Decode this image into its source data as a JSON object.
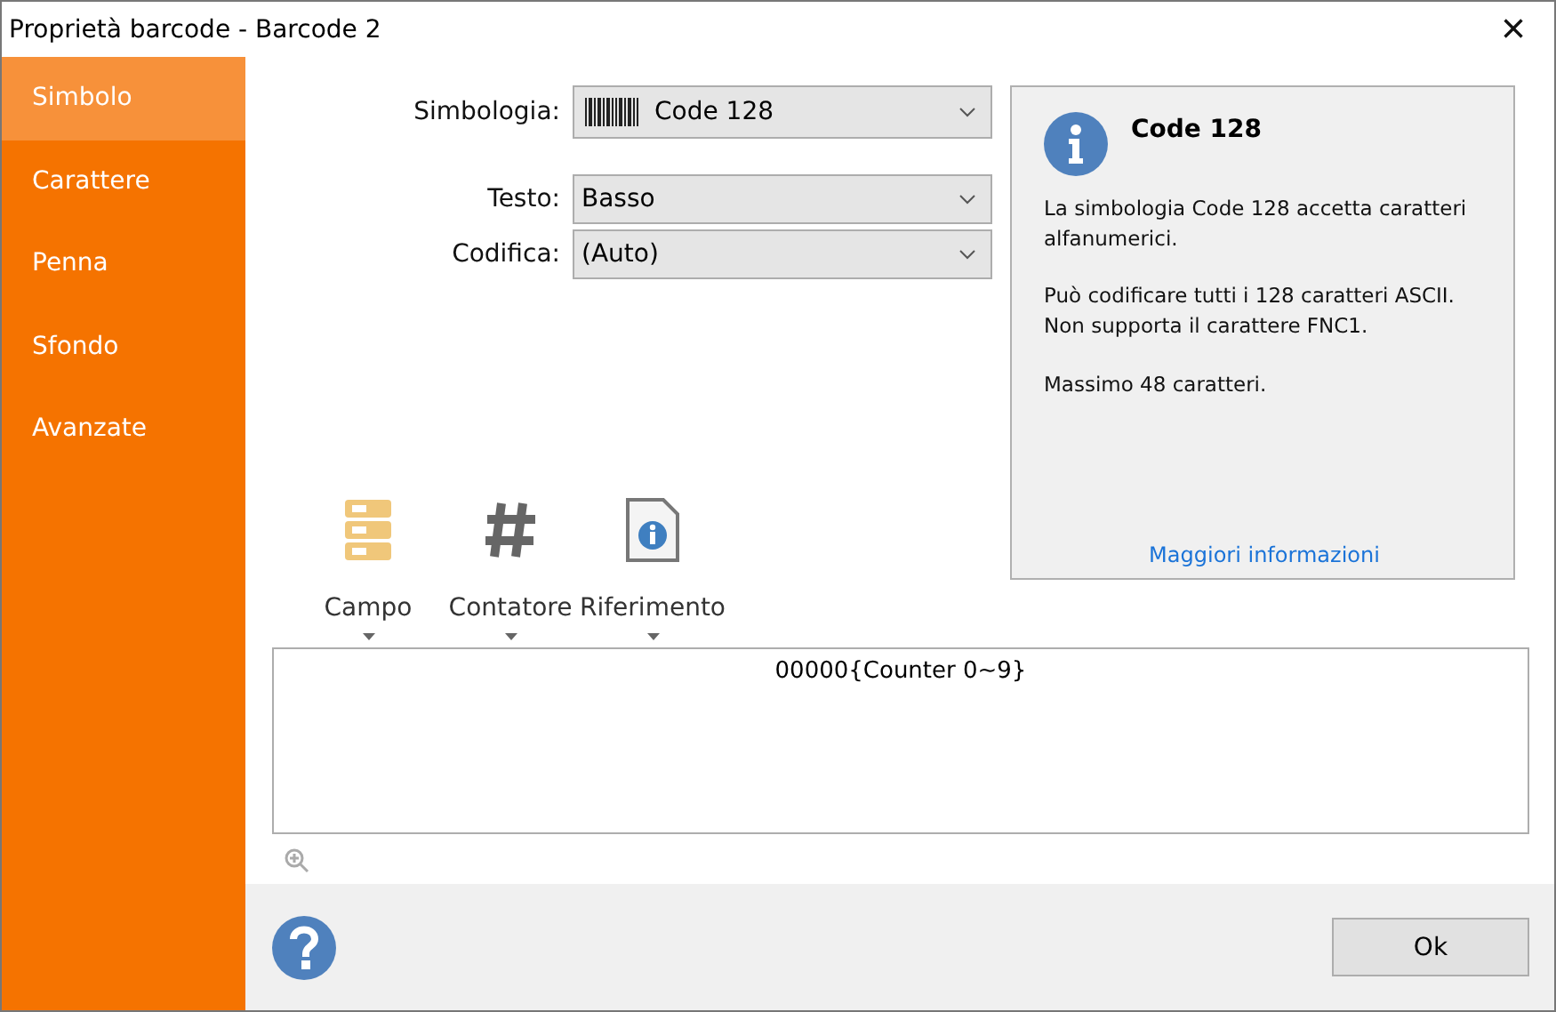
{
  "window": {
    "title": "Proprietà barcode - Barcode 2",
    "close": "×"
  },
  "sidebar": {
    "items": [
      {
        "label": "Simbolo",
        "selected": true
      },
      {
        "label": "Carattere",
        "selected": false
      },
      {
        "label": "Penna",
        "selected": false
      },
      {
        "label": "Sfondo",
        "selected": false
      },
      {
        "label": "Avanzate",
        "selected": false
      }
    ]
  },
  "form": {
    "fields": [
      {
        "label": "Simbologia:",
        "value": "Code 128",
        "kind": "barcode"
      },
      {
        "label": "Testo:",
        "value": "Basso",
        "kind": "plain"
      },
      {
        "label": "Codifica:",
        "value": "(Auto)",
        "kind": "plain"
      }
    ]
  },
  "info": {
    "title": "Code 128",
    "paragraphs": [
      "La simbologia Code 128 accetta caratteri\nalfanumerici.",
      "Può codificare tutti i 128 caratteri ASCII.\nNon supporta il carattere FNC1.",
      "Massimo 48 caratteri."
    ],
    "link": "Maggiori informazioni"
  },
  "toolbar": [
    {
      "label": "Campo",
      "kind": "field"
    },
    {
      "label": "Contatore",
      "kind": "counter"
    },
    {
      "label": "Riferimento",
      "kind": "reference"
    }
  ],
  "editor": {
    "value": "00000{Counter 0~9}"
  },
  "footer": {
    "ok": "Ok"
  }
}
